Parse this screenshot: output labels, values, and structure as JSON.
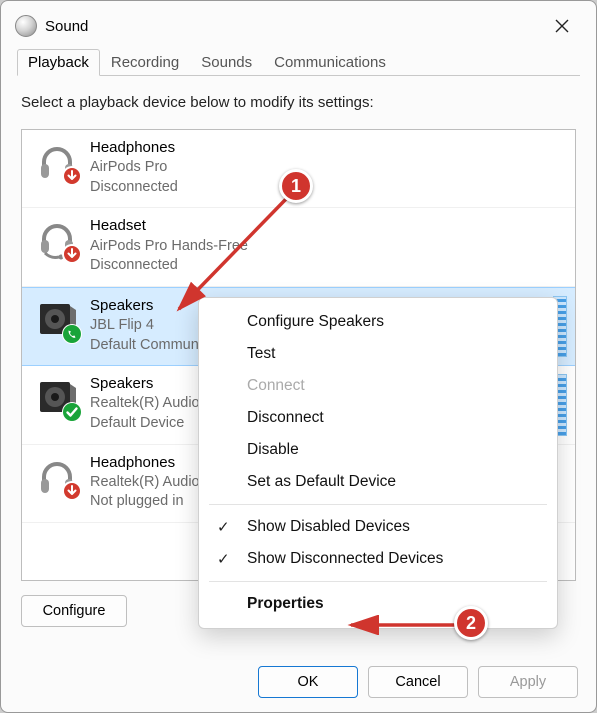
{
  "window": {
    "title": "Sound"
  },
  "tabs": [
    "Playback",
    "Recording",
    "Sounds",
    "Communications"
  ],
  "active_tab": 0,
  "instruction": "Select a playback device below to modify its settings:",
  "devices": [
    {
      "name": "Headphones",
      "sub": "AirPods Pro",
      "status": "Disconnected",
      "icon": "headphones",
      "overlay": "down-red",
      "selected": false,
      "level": false
    },
    {
      "name": "Headset",
      "sub": "AirPods Pro Hands-Free",
      "status": "Disconnected",
      "icon": "headset",
      "overlay": "down-red",
      "selected": false,
      "level": false
    },
    {
      "name": "Speakers",
      "sub": "JBL Flip 4",
      "status": "Default Communications Device",
      "icon": "speaker-dark",
      "overlay": "phone-green",
      "selected": true,
      "level": true
    },
    {
      "name": "Speakers",
      "sub": "Realtek(R) Audio",
      "status": "Default Device",
      "icon": "speaker-dark",
      "overlay": "check-green",
      "selected": false,
      "level": true
    },
    {
      "name": "Headphones",
      "sub": "Realtek(R) Audio",
      "status": "Not plugged in",
      "icon": "headphones",
      "overlay": "down-red",
      "selected": false,
      "level": false
    }
  ],
  "configure_button": "Configure",
  "context_menu": {
    "items": [
      {
        "label": "Configure Speakers",
        "type": "item"
      },
      {
        "label": "Test",
        "type": "item"
      },
      {
        "label": "Connect",
        "type": "disabled"
      },
      {
        "label": "Disconnect",
        "type": "item"
      },
      {
        "label": "Disable",
        "type": "item"
      },
      {
        "label": "Set as Default Device",
        "type": "item"
      },
      {
        "type": "sep"
      },
      {
        "label": "Show Disabled Devices",
        "type": "check"
      },
      {
        "label": "Show Disconnected Devices",
        "type": "check"
      },
      {
        "type": "sep"
      },
      {
        "label": "Properties",
        "type": "bold"
      }
    ]
  },
  "buttons": {
    "ok": "OK",
    "cancel": "Cancel",
    "apply": "Apply"
  },
  "annotations": {
    "badge1": "1",
    "badge2": "2"
  }
}
